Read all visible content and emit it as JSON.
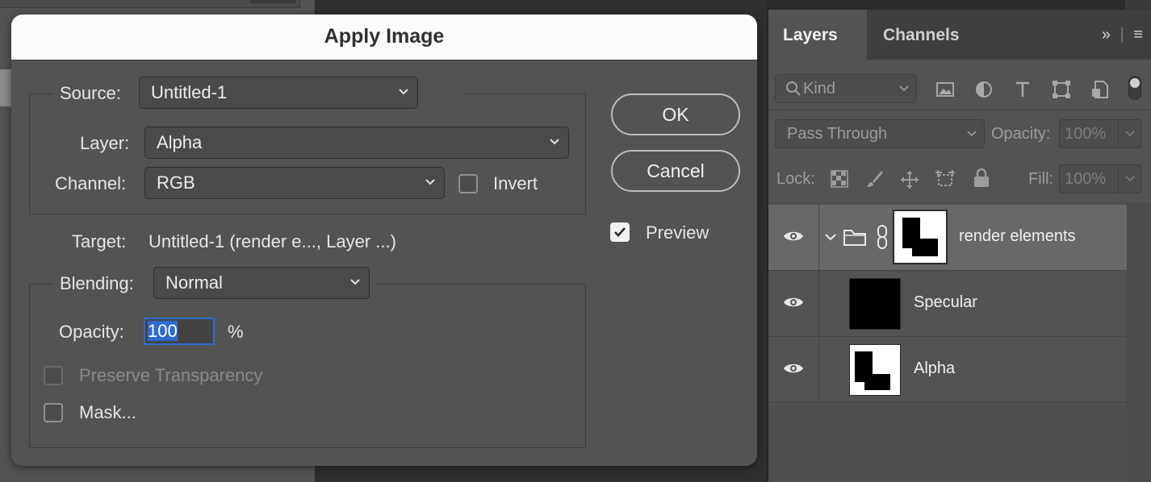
{
  "dialog": {
    "title": "Apply Image",
    "source": {
      "label": "Source:",
      "value": "Untitled-1"
    },
    "layer": {
      "label": "Layer:",
      "value": "Alpha"
    },
    "channel": {
      "label": "Channel:",
      "value": "RGB"
    },
    "invert": {
      "label": "Invert",
      "checked": false
    },
    "target": {
      "label": "Target:",
      "value": "Untitled-1 (render e..., Layer ...)"
    },
    "blending": {
      "label": "Blending:",
      "value": "Normal"
    },
    "opacity": {
      "label": "Opacity:",
      "value": "100",
      "unit": "%"
    },
    "preserve_transparency": {
      "label": "Preserve Transparency",
      "checked": false,
      "disabled": true
    },
    "mask": {
      "label": "Mask...",
      "checked": false
    },
    "ok_label": "OK",
    "cancel_label": "Cancel",
    "preview": {
      "label": "Preview",
      "checked": true
    }
  },
  "layers_panel": {
    "tabs": [
      {
        "label": "Layers",
        "active": true
      },
      {
        "label": "Channels",
        "active": false
      }
    ],
    "filter": {
      "placeholder": "Kind"
    },
    "blend_mode": "Pass Through",
    "opacity_label": "Opacity:",
    "opacity_value": "100%",
    "lock_label": "Lock:",
    "fill_label": "Fill:",
    "fill_value": "100%",
    "layers": [
      {
        "name": "render elements",
        "type": "group",
        "visible": true,
        "selected": true
      },
      {
        "name": "Specular",
        "type": "layer",
        "visible": true,
        "selected": false
      },
      {
        "name": "Alpha",
        "type": "layer",
        "visible": true,
        "selected": false
      }
    ]
  },
  "colors": {
    "dialog_bg": "#535353",
    "title_bar": "#fbfbfb",
    "selection_blue": "#2f6bd0",
    "selected_layer": "#686868"
  }
}
